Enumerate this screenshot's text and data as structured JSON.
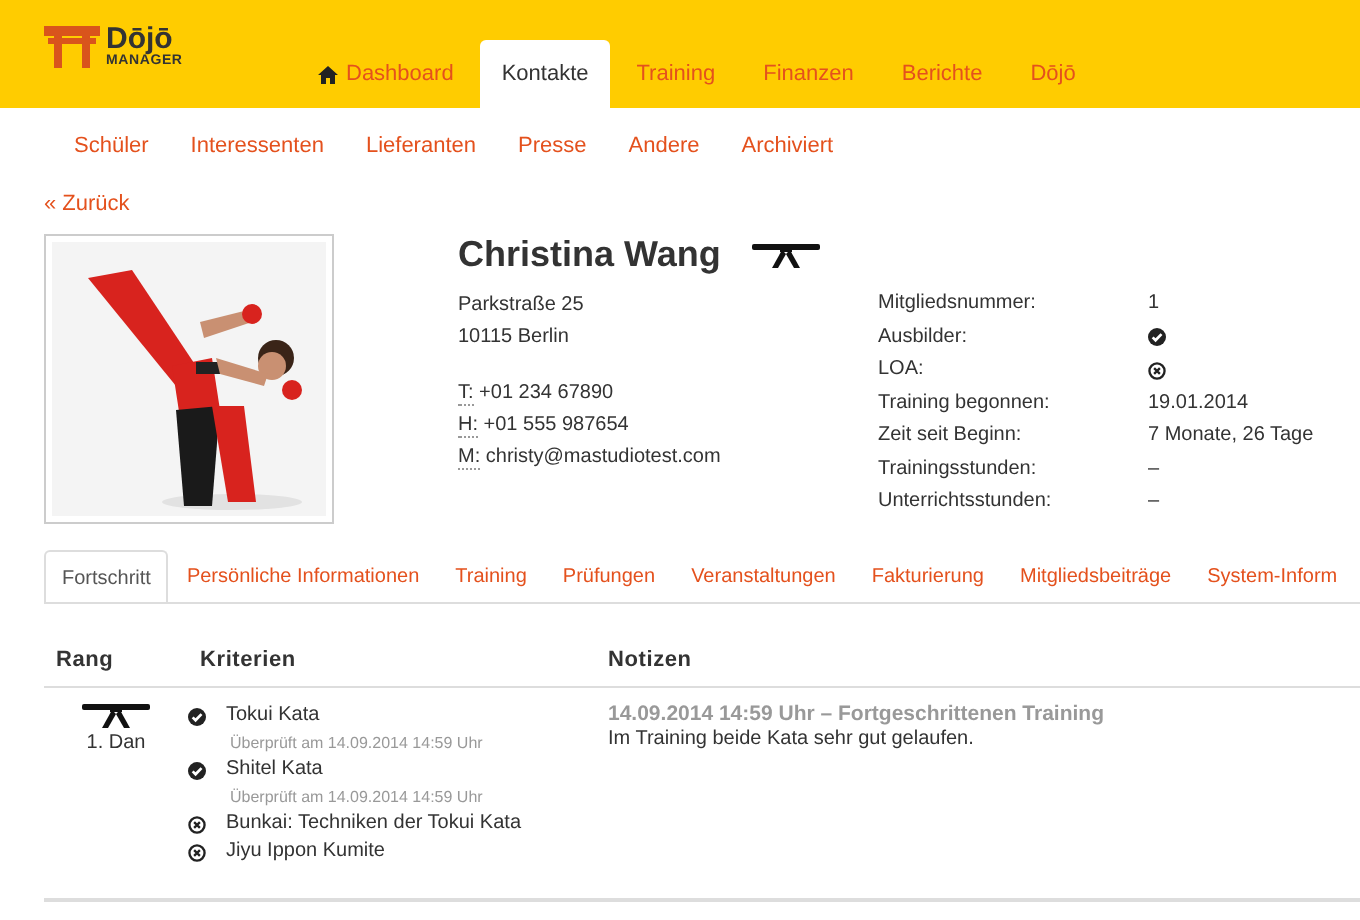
{
  "logo": {
    "title": "Dōjō",
    "subtitle": "MANAGER"
  },
  "main_nav": [
    {
      "label": "Dashboard",
      "kind": "home",
      "selected": false
    },
    {
      "label": "Kontakte",
      "selected": true
    },
    {
      "label": "Training",
      "selected": false
    },
    {
      "label": "Finanzen",
      "selected": false
    },
    {
      "label": "Berichte",
      "selected": false
    },
    {
      "label": "Dōjō",
      "selected": false
    }
  ],
  "sub_nav": [
    "Schüler",
    "Interessenten",
    "Lieferanten",
    "Presse",
    "Andere",
    "Archiviert"
  ],
  "back_link": "« Zurück",
  "profile": {
    "name": "Christina Wang",
    "address": [
      "Parkstraße 25",
      "10115 Berlin"
    ],
    "contacts": [
      {
        "prefix": "T:",
        "value": "+01 234 67890"
      },
      {
        "prefix": "H:",
        "value": "+01 555 987654"
      },
      {
        "prefix": "M:",
        "value": "christy@mastudiotest.com"
      }
    ],
    "details": [
      {
        "label": "Mitgliedsnummer:",
        "kind": "text",
        "value": "1"
      },
      {
        "label": "Ausbilder:",
        "kind": "check",
        "checked": true
      },
      {
        "label": "LOA:",
        "kind": "check",
        "checked": false
      },
      {
        "label": "Training begonnen:",
        "kind": "text",
        "value": "19.01.2014"
      },
      {
        "label": "Zeit seit Beginn:",
        "kind": "text",
        "value": "7 Monate, 26 Tage"
      },
      {
        "label": "Trainingsstunden:",
        "kind": "text",
        "value": "–"
      },
      {
        "label": "Unterrichtsstunden:",
        "kind": "text",
        "value": "–"
      }
    ]
  },
  "tabs": [
    {
      "label": "Fortschritt",
      "selected": true
    },
    {
      "label": "Persönliche Informationen",
      "selected": false
    },
    {
      "label": "Training",
      "selected": false
    },
    {
      "label": "Prüfungen",
      "selected": false
    },
    {
      "label": "Veranstaltungen",
      "selected": false
    },
    {
      "label": "Fakturierung",
      "selected": false
    },
    {
      "label": "Mitgliedsbeiträge",
      "selected": false
    },
    {
      "label": "System-Inform",
      "selected": false
    }
  ],
  "table": {
    "columns": [
      "Rang",
      "Kriterien",
      "Notizen"
    ],
    "rows": [
      {
        "rank": "1. Dan",
        "criteria": [
          {
            "name": "Tokui Kata",
            "checked": true,
            "note": "Überprüft am 14.09.2014 14:59 Uhr"
          },
          {
            "name": "Shitel Kata",
            "checked": true,
            "note": "Überprüft am 14.09.2014 14:59 Uhr"
          },
          {
            "name": "Bunkai: Techniken der Tokui Kata",
            "checked": false
          },
          {
            "name": "Jiyu Ippon Kumite",
            "checked": false
          }
        ],
        "notes": [
          {
            "title": "14.09.2014 14:59 Uhr – Fortgeschrittenen Training",
            "text": "Im Training beide Kata sehr gut gelaufen."
          }
        ]
      }
    ]
  }
}
